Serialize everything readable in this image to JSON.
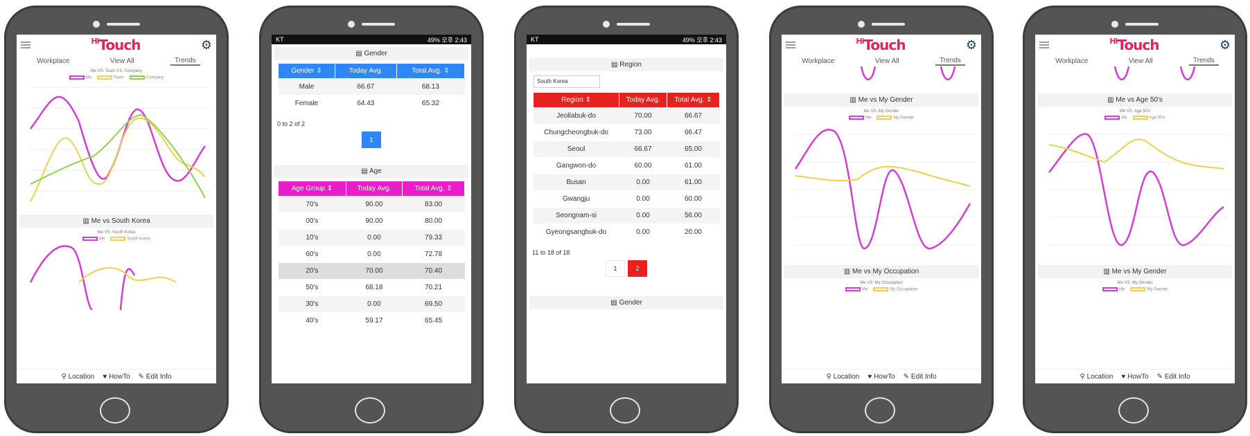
{
  "brand": {
    "hi": "Hi",
    "name": "Touch"
  },
  "tabs": [
    "Workplace",
    "View All",
    "Trends"
  ],
  "footer": {
    "location": "Location",
    "howto": "HowTo",
    "edit": "Edit Info"
  },
  "phone1": {
    "chart1_title": "Me VS. Team VS. Company",
    "chart1_legend": [
      "Me",
      "Team",
      "Company"
    ],
    "section": "Me vs South Korea",
    "chart2_title": "Me VS. South Korea",
    "chart2_legend": [
      "Me",
      "South Korea"
    ]
  },
  "phone2": {
    "status_left": "KT",
    "status_right": "49% 오후 2:43",
    "gender_title": "Gender",
    "gender_cols": [
      "Gender ⇕",
      "Today Avg.",
      "Total Avg. ⇕"
    ],
    "gender_rows": [
      [
        "Male",
        "66.67",
        "68.13"
      ],
      [
        "Female",
        "64.43",
        "65.32"
      ]
    ],
    "gender_info": "0 to 2 of 2",
    "gender_page": "1",
    "age_title": "Age",
    "age_cols": [
      "Age Group ⇕",
      "Today Avg.",
      "Total Avg. ⇕"
    ],
    "age_rows": [
      [
        "70's",
        "90.00",
        "83.00"
      ],
      [
        "00's",
        "90.00",
        "80.00"
      ],
      [
        "10's",
        "0.00",
        "79.33"
      ],
      [
        "60's",
        "0.00",
        "72.78"
      ],
      [
        "20's",
        "70.00",
        "70.40"
      ],
      [
        "50's",
        "68.18",
        "70.21"
      ],
      [
        "30's",
        "0.00",
        "69.50"
      ],
      [
        "40's",
        "59.17",
        "65.45"
      ]
    ]
  },
  "phone3": {
    "status_left": "KT",
    "status_right": "49% 오후 2:43",
    "region_title": "Region",
    "region_select": "South Korea",
    "region_cols": [
      "Region ⇕",
      "Today Avg.",
      "Total Avg. ⇕"
    ],
    "region_rows": [
      [
        "Jeollabuk-do",
        "70.00",
        "66.67"
      ],
      [
        "Chungcheongbuk-do",
        "73.00",
        "66.47"
      ],
      [
        "Seoul",
        "66.67",
        "65.00"
      ],
      [
        "Gangwon-do",
        "60.00",
        "61.00"
      ],
      [
        "Busan",
        "0.00",
        "61.00"
      ],
      [
        "Gwangju",
        "0.00",
        "60.00"
      ],
      [
        "Seongnam-si",
        "0.00",
        "56.00"
      ],
      [
        "Gyeongsangbuk-do",
        "0.00",
        "20.00"
      ]
    ],
    "region_info": "11 to 18 of 18",
    "pages": [
      "1",
      "2"
    ],
    "gender_title": "Gender"
  },
  "phone4": {
    "section1": "Me vs My Gender",
    "chart_title": "Me VS. My Gender",
    "legend": [
      "Me",
      "My Gender"
    ],
    "section2": "Me vs My Occupation",
    "chart2_title": "Me VS. My Occupation",
    "legend2": [
      "Me",
      "My Occupation"
    ]
  },
  "phone5": {
    "section1": "Me vs Age 50's",
    "chart_title": "Me VS. Age 50's",
    "legend": [
      "Me",
      "Age 50's"
    ],
    "section2": "Me vs My Gender",
    "chart2_title": "Me VS. My Gender",
    "legend2": [
      "Me",
      "My Gender"
    ]
  },
  "colors": {
    "me": "#d63bd6",
    "team": "#f2cf4a",
    "company": "#8ed34a",
    "blue": "#2f86f6",
    "magenta": "#e91ec8",
    "red": "#e8201e"
  }
}
